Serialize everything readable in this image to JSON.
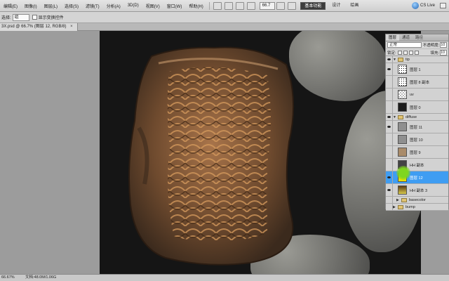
{
  "menubar": {
    "items": [
      "编辑(E)",
      "图像(I)",
      "图层(L)",
      "选择(S)",
      "滤镜(T)",
      "分析(A)",
      "3D(D)",
      "视图(V)",
      "窗口(W)",
      "帮助(H)"
    ],
    "zoom": "66.7",
    "workspaces": {
      "active": "基本功能",
      "design": "设计",
      "more": "绘画"
    },
    "cslive": "CS Live"
  },
  "options": {
    "select_label": "选择:",
    "select_value": "组",
    "checkbox_label": "显示变换控件"
  },
  "document": {
    "tab_label": "3X.psd @ 66.7% (图层 12, RGB/8)",
    "close_glyph": "×"
  },
  "layers_panel": {
    "tabs": [
      "图层",
      "通道",
      "路径"
    ],
    "blend_mode": "正常",
    "opacity_label": "不透明度:",
    "opacity_value": "10",
    "lock_label": "锁定:",
    "fill_label": "填充:",
    "fill_value": "10",
    "groups": {
      "tip": "tip",
      "diffuse": "diffuse",
      "bump": "bump"
    },
    "tip_layers": [
      {
        "name": "图层 1",
        "thumb": "dots"
      },
      {
        "name": "图层 8 副本",
        "thumb": "dots"
      },
      {
        "name": "uv",
        "thumb": "check"
      },
      {
        "name": "图层 0",
        "thumb": "dark"
      }
    ],
    "diffuse_layers": [
      {
        "name": "图层 11",
        "thumb": "grey"
      },
      {
        "name": "图层 10",
        "thumb": "grey"
      },
      {
        "name": "图层 9",
        "thumb": "tan"
      },
      {
        "name": "HH 副本",
        "thumb": "mask"
      },
      {
        "name": "图层 12",
        "thumb": "yellow",
        "selected": true
      },
      {
        "name": "HH 副本 3",
        "thumb": "yellow2"
      }
    ],
    "basecolor_label": "basecolor"
  },
  "status": {
    "zoom": "66.67%",
    "doc": "文档:48.0M/1.06G"
  }
}
